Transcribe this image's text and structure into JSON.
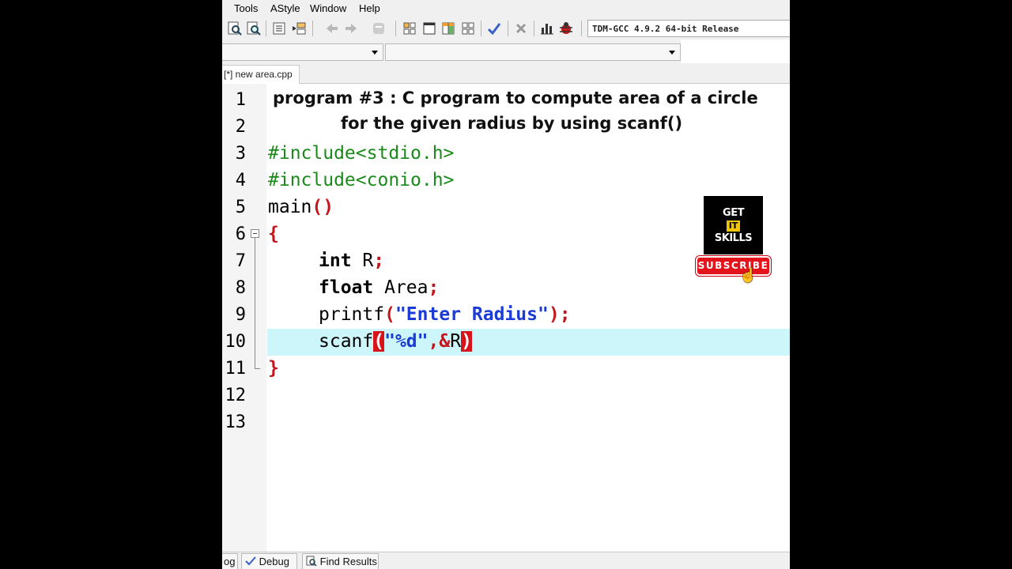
{
  "menu": [
    "Tools",
    "AStyle",
    "Window",
    "Help"
  ],
  "toolbar": {
    "compiler": "TDM-GCC 4.9.2 64-bit Release",
    "icons": [
      "find-icon",
      "replace-icon",
      "indent-icon",
      "unindent-icon",
      "back-icon",
      "forward-icon",
      "goto-icon",
      "grid-icon",
      "window-icon",
      "table-icon",
      "layout-icon",
      "check-icon",
      "close-icon",
      "chart-icon",
      "debug-icon"
    ]
  },
  "tab": {
    "label": "[*] new area.cpp"
  },
  "editor": {
    "title_line1": "program #3 : C program to compute area of a circle",
    "title_line2": "for the given radius by using scanf()",
    "line_numbers": [
      "1",
      "2",
      "3",
      "4",
      "5",
      "6",
      "7",
      "8",
      "9",
      "10",
      "11",
      "12",
      "13"
    ],
    "current_line": 10,
    "code": {
      "include1": "#include<stdio.h>",
      "include2": "#include<conio.h>",
      "main_name": "main",
      "main_parens": "()",
      "brace_open": "{",
      "l7_kw": "int",
      "l7_rest": " R",
      "l7_semi": ";",
      "l8_kw": "float",
      "l8_rest": " Area",
      "l8_semi": ";",
      "l9_fn": "printf",
      "l9_open": "(",
      "l9_str": "\"Enter Radius\"",
      "l9_close": ")",
      "l9_semi": ";",
      "l10_fn": "scanf",
      "l10_open": "(",
      "l10_str": "\"%d\"",
      "l10_comma": ",",
      "l10_amp": "&",
      "l10_var": "R",
      "l10_close": ")",
      "brace_close": "}"
    }
  },
  "overlay": {
    "logo_top": "GET",
    "logo_mid": "IT",
    "logo_bottom": "SKILLS",
    "subscribe": "SUBSCRIBE"
  },
  "bottom_tabs": [
    "og",
    "Debug",
    "Find Results"
  ]
}
